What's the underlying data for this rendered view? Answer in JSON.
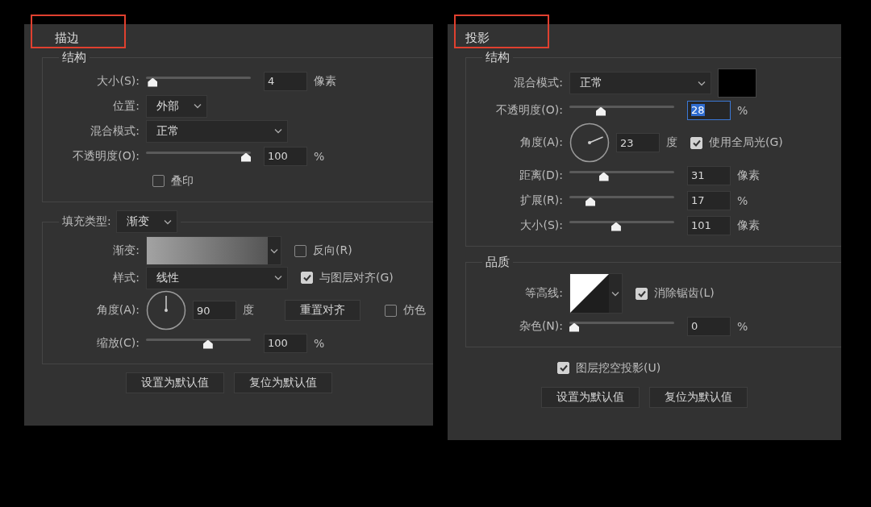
{
  "panels": [
    {
      "title": "描边",
      "highlighted": true,
      "sections": [
        {
          "legend": {
            "kind": "heading",
            "label": "结构"
          },
          "rows": [
            {
              "label": "大小(S):",
              "controls": [
                {
                  "kind": "slider",
                  "level": 0.02
                },
                {
                  "kind": "field",
                  "value": "4",
                  "focused": false
                },
                {
                  "kind": "unit",
                  "text": "像素"
                }
              ]
            },
            {
              "label": "位置:",
              "controls": [
                {
                  "kind": "select_compact",
                  "value": "外部"
                }
              ]
            },
            {
              "label": "混合模式:",
              "controls": [
                {
                  "kind": "select",
                  "value": "正常"
                }
              ]
            },
            {
              "label": "不透明度(O):",
              "controls": [
                {
                  "kind": "slider",
                  "level": 1
                },
                {
                  "kind": "field",
                  "value": "100",
                  "focused": false
                },
                {
                  "kind": "unit",
                  "text": "%"
                }
              ]
            },
            {
              "controls": [
                {
                  "kind": "checkbox",
                  "label": "叠印",
                  "checked": false
                }
              ]
            }
          ]
        },
        {
          "legend": {
            "kind": "field",
            "label": "填充类型:",
            "controls": [
              {
                "kind": "select_compact",
                "value": "渐变"
              }
            ]
          },
          "rows": [
            {
              "label": "渐变:",
              "controls": [
                {
                  "kind": "gradient"
                },
                {
                  "kind": "checkbox",
                  "label": "反向(R)",
                  "checked": false
                }
              ]
            },
            {
              "label": "样式:",
              "controls": [
                {
                  "kind": "select",
                  "value": "线性"
                },
                {
                  "kind": "checkbox",
                  "label": "与图层对齐(G)",
                  "checked": true
                }
              ]
            },
            {
              "label": "角度(A):",
              "controls": [
                {
                  "kind": "dial"
                },
                {
                  "kind": "field",
                  "value": "90",
                  "focused": false
                },
                {
                  "kind": "unit",
                  "text": "度"
                },
                {
                  "kind": "button",
                  "label": "重置对齐"
                },
                {
                  "kind": "checkbox",
                  "label": "仿色",
                  "checked": false
                }
              ]
            },
            {
              "label": "缩放(C):",
              "controls": [
                {
                  "kind": "slider",
                  "level": 0.6
                },
                {
                  "kind": "field",
                  "value": "100",
                  "focused": false
                },
                {
                  "kind": "unit",
                  "text": "%"
                }
              ]
            }
          ]
        }
      ],
      "buttons": [
        "设置为默认值",
        "复位为默认值"
      ]
    },
    {
      "title": "投影",
      "highlighted": true,
      "sections": [
        {
          "legend": {
            "kind": "heading",
            "label": "结构"
          },
          "rows": [
            {
              "label": "混合模式:",
              "controls": [
                {
                  "kind": "select",
                  "value": "正常"
                },
                {
                  "kind": "swatch",
                  "color": "#000000"
                }
              ]
            },
            {
              "label": "不透明度(O):",
              "controls": [
                {
                  "kind": "slider",
                  "level": 0.28
                },
                {
                  "kind": "field",
                  "value": "28",
                  "focused": true
                },
                {
                  "kind": "unit",
                  "text": "%"
                }
              ]
            },
            {
              "label": "角度(A):",
              "controls": [
                {
                  "kind": "dial"
                },
                {
                  "kind": "field",
                  "value": "23",
                  "focused": false
                },
                {
                  "kind": "unit",
                  "text": "度"
                },
                {
                  "kind": "checkbox",
                  "label": "使用全局光(G)",
                  "checked": true
                }
              ]
            },
            {
              "label": "距离(D):",
              "controls": [
                {
                  "kind": "slider",
                  "level": 0.31
                },
                {
                  "kind": "field",
                  "value": "31",
                  "focused": false
                },
                {
                  "kind": "unit",
                  "text": "像素"
                }
              ]
            },
            {
              "label": "扩展(R):",
              "controls": [
                {
                  "kind": "slider",
                  "level": 0.17
                },
                {
                  "kind": "field",
                  "value": "17",
                  "focused": false
                },
                {
                  "kind": "unit",
                  "text": "%"
                }
              ]
            },
            {
              "label": "大小(S):",
              "controls": [
                {
                  "kind": "slider",
                  "level": 0.44
                },
                {
                  "kind": "field",
                  "value": "101",
                  "focused": false
                },
                {
                  "kind": "unit",
                  "text": "像素"
                }
              ]
            }
          ]
        },
        {
          "legend": {
            "kind": "heading",
            "label": "品质"
          },
          "rows": [
            {
              "label": "等高线:",
              "controls": [
                {
                  "kind": "contour"
                },
                {
                  "kind": "checkbox",
                  "label": "消除锯齿(L)",
                  "checked": true
                }
              ]
            },
            {
              "label": "杂色(N):",
              "controls": [
                {
                  "kind": "slider",
                  "level": 0
                },
                {
                  "kind": "field",
                  "value": "0",
                  "focused": false
                },
                {
                  "kind": "unit",
                  "text": "%"
                }
              ]
            }
          ]
        }
      ],
      "extras": [
        {
          "controls": [
            {
              "kind": "checkbox",
              "label": "图层挖空投影(U)",
              "checked": true
            }
          ]
        }
      ],
      "buttons": [
        "设置为默认值",
        "复位为默认值"
      ]
    }
  ]
}
